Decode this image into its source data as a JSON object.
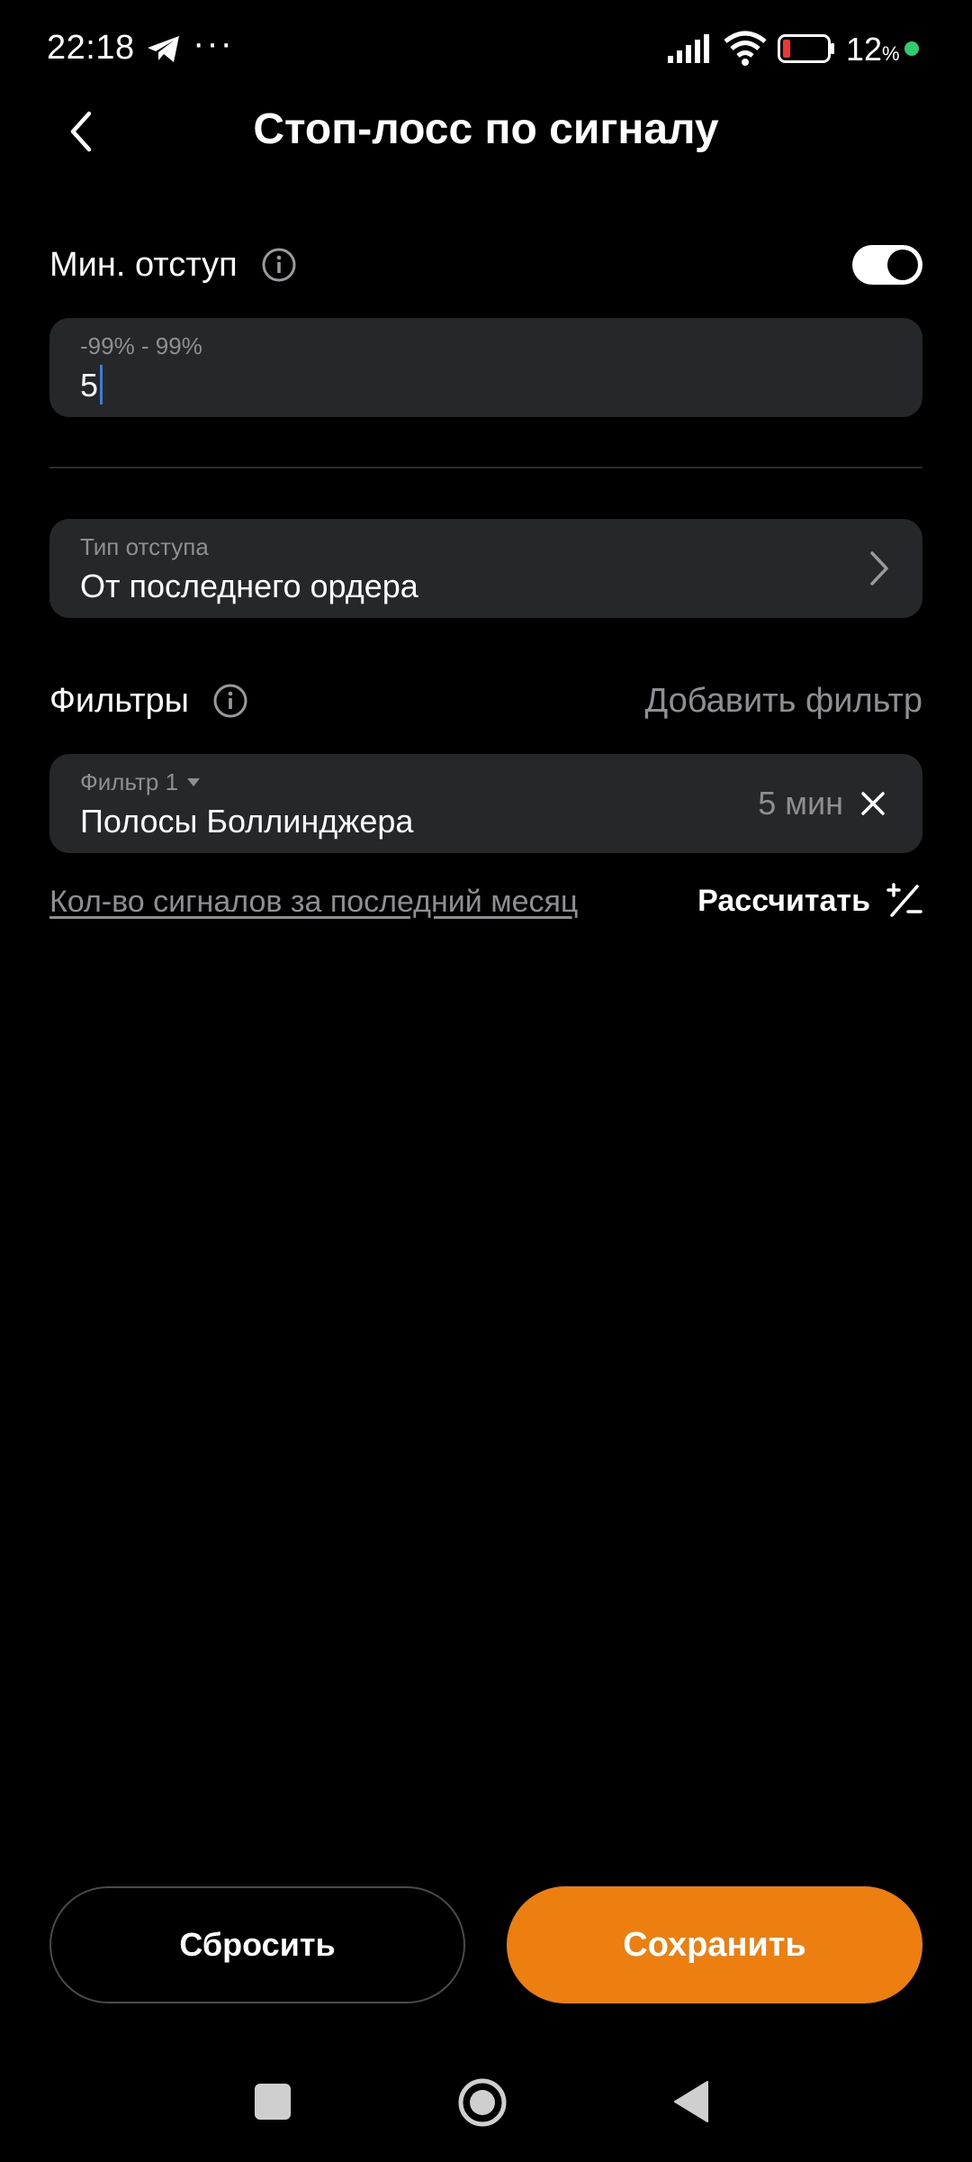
{
  "status_bar": {
    "time": "22:18",
    "dots": "···",
    "battery_pct": "12",
    "pct_sign": "%",
    "status_dot_color": "#2ecc71",
    "battery_level_color": "#e53935"
  },
  "header": {
    "title": "Стоп-лосс по сигналу"
  },
  "min_offset": {
    "label": "Мин. отступ",
    "enabled": true,
    "range_hint": "-99% - 99%",
    "value": "5"
  },
  "offset_type": {
    "hint": "Тип отступа",
    "value": "От последнего ордера"
  },
  "filters": {
    "label": "Фильтры",
    "add_label": "Добавить фильтр",
    "items": [
      {
        "hint": "Фильтр 1",
        "name": "Полосы Боллинджера",
        "timeframe": "5 мин"
      }
    ]
  },
  "signals": {
    "link_label": "Кол-во сигналов за последний месяц",
    "calc_label": "Рассчитать"
  },
  "actions": {
    "reset_label": "Сбросить",
    "save_label": "Сохранить",
    "save_color": "#ed7f10"
  }
}
